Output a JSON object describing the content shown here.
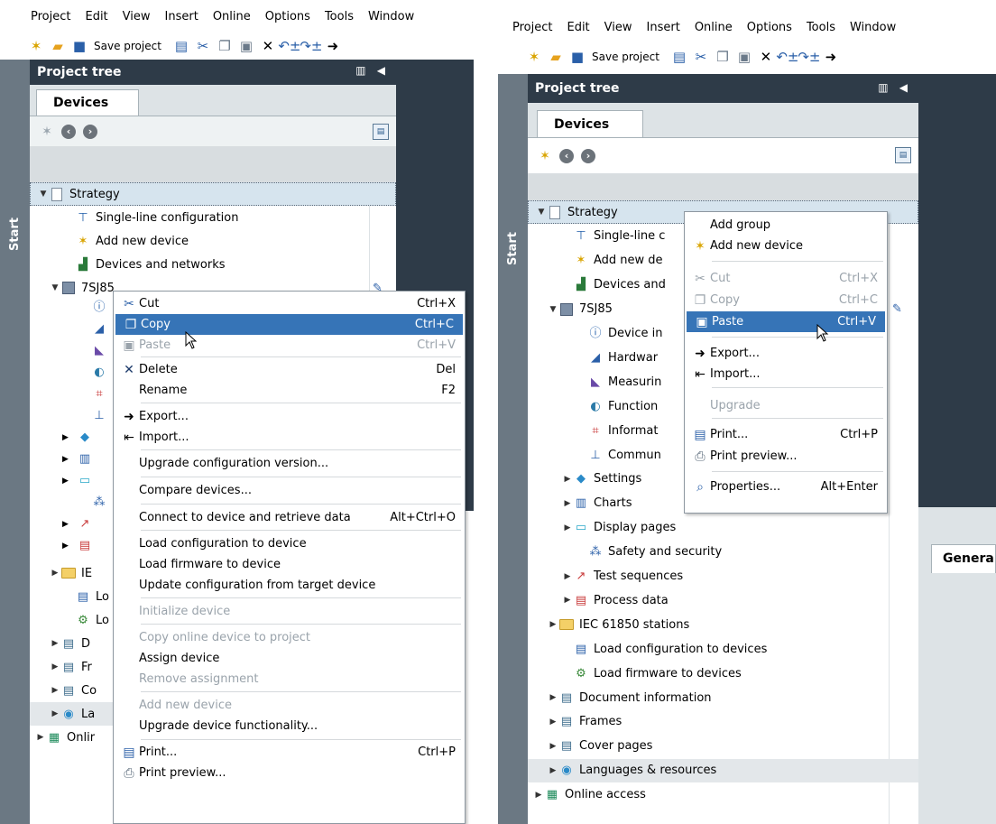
{
  "menus": [
    "Project",
    "Edit",
    "View",
    "Insert",
    "Online",
    "Options",
    "Tools",
    "Window"
  ],
  "toolbar": {
    "save_label": "Save project"
  },
  "start_label": "Start",
  "project_tree": {
    "title": "Project tree",
    "tab": "Devices"
  },
  "left_tree": [
    {
      "label": "Strategy"
    },
    {
      "label": "Single-line configuration"
    },
    {
      "label": "Add new device"
    },
    {
      "label": "Devices and networks"
    },
    {
      "label": "7SJ85"
    },
    {
      "label": "IE"
    },
    {
      "label": "Lo"
    },
    {
      "label": "Lo"
    },
    {
      "label": "D"
    },
    {
      "label": "Fr"
    },
    {
      "label": "Co"
    },
    {
      "label": "La"
    },
    {
      "label": "Onlir"
    }
  ],
  "left_menu": [
    {
      "label": "Cut",
      "shortcut": "Ctrl+X",
      "icon": "scissors-icon"
    },
    {
      "label": "Copy",
      "shortcut": "Ctrl+C",
      "icon": "copy-icon"
    },
    {
      "label": "Paste",
      "shortcut": "Ctrl+V",
      "icon": "paste-icon"
    },
    {
      "label": "Delete",
      "shortcut": "Del",
      "icon": "delete-x-icon"
    },
    {
      "label": "Rename",
      "shortcut": "F2"
    },
    {
      "label": "Export...",
      "icon": "export-arrow-icon"
    },
    {
      "label": "Import...",
      "icon": "import-arrow-icon"
    },
    {
      "label": "Upgrade configuration version..."
    },
    {
      "label": "Compare devices..."
    },
    {
      "label": "Connect to device and retrieve data",
      "shortcut": "Alt+Ctrl+O"
    },
    {
      "label": "Load configuration to device"
    },
    {
      "label": "Load firmware to device"
    },
    {
      "label": "Update configuration from target device"
    },
    {
      "label": "Initialize device"
    },
    {
      "label": "Copy online device to project"
    },
    {
      "label": "Assign device"
    },
    {
      "label": "Remove assignment"
    },
    {
      "label": "Add new device"
    },
    {
      "label": "Upgrade device functionality..."
    },
    {
      "label": "Print...",
      "shortcut": "Ctrl+P",
      "icon": "printer-icon"
    },
    {
      "label": "Print preview...",
      "icon": "print-preview-icon"
    }
  ],
  "right_tree": [
    {
      "label": "Strategy"
    },
    {
      "label": "Single-line c"
    },
    {
      "label": "Add new de"
    },
    {
      "label": "Devices and"
    },
    {
      "label": "7SJ85"
    },
    {
      "label": "Device in"
    },
    {
      "label": "Hardwar"
    },
    {
      "label": "Measurin"
    },
    {
      "label": "Function"
    },
    {
      "label": "Informat"
    },
    {
      "label": "Commun"
    },
    {
      "label": "Settings"
    },
    {
      "label": "Charts"
    },
    {
      "label": "Display pages"
    },
    {
      "label": "Safety and security"
    },
    {
      "label": "Test sequences"
    },
    {
      "label": "Process data"
    },
    {
      "label": "IEC 61850 stations"
    },
    {
      "label": "Load configuration to devices"
    },
    {
      "label": "Load firmware to devices"
    },
    {
      "label": "Document information"
    },
    {
      "label": "Frames"
    },
    {
      "label": "Cover pages"
    },
    {
      "label": "Languages & resources"
    },
    {
      "label": "Online access"
    }
  ],
  "right_menu": [
    {
      "label": "Add group"
    },
    {
      "label": "Add new device",
      "icon": "add-device-icon"
    },
    {
      "label": "Cut",
      "shortcut": "Ctrl+X",
      "icon": "scissors-icon"
    },
    {
      "label": "Copy",
      "shortcut": "Ctrl+C",
      "icon": "copy-icon"
    },
    {
      "label": "Paste",
      "shortcut": "Ctrl+V",
      "icon": "paste-icon"
    },
    {
      "label": "Export...",
      "icon": "export-arrow-icon"
    },
    {
      "label": "Import...",
      "icon": "import-arrow-icon"
    },
    {
      "label": "Upgrade"
    },
    {
      "label": "Print...",
      "shortcut": "Ctrl+P",
      "icon": "printer-icon"
    },
    {
      "label": "Print preview...",
      "icon": "print-preview-icon"
    },
    {
      "label": "Properties...",
      "shortcut": "Alt+Enter",
      "icon": "properties-icon"
    }
  ],
  "general_tab": "Genera",
  "colors": {
    "tree_header": "#2e3b48",
    "menu_highlight": "#3674b7",
    "start_strip": "#6b7883",
    "selection": "#d6e4ee"
  }
}
